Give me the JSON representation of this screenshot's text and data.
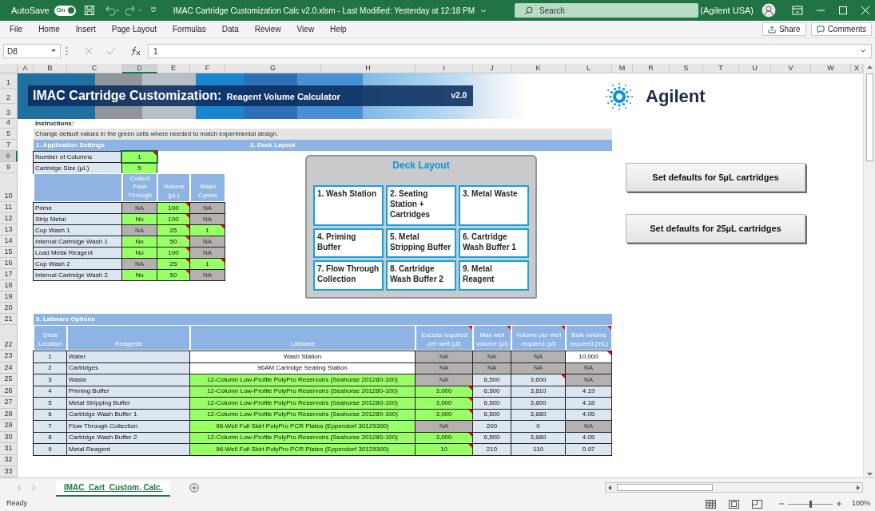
{
  "title_bar": {
    "autosave_label": "AutoSave",
    "autosave": {
      "label": "On",
      "on": true
    },
    "file_title": "IMAC Cartridge Customization Calc v2.0.xlsm  -  Last Modified: Yesterday at 12:18 PM",
    "search_placeholder": "Search",
    "account": "(Agilent USA)"
  },
  "menu": [
    "File",
    "Home",
    "Insert",
    "Page Layout",
    "Formulas",
    "Data",
    "Review",
    "View",
    "Help"
  ],
  "share_label": "Share",
  "comments_label": "Comments",
  "formula_bar": {
    "name_box": "D8",
    "formula": "1"
  },
  "columns": [
    {
      "label": "A",
      "selected": false
    },
    {
      "label": "B",
      "selected": false
    },
    {
      "label": "C",
      "selected": false
    },
    {
      "label": "D",
      "selected": true
    },
    {
      "label": "E",
      "selected": false
    },
    {
      "label": "F",
      "selected": false
    },
    {
      "label": "G",
      "selected": false
    },
    {
      "label": "H",
      "selected": false
    },
    {
      "label": "I",
      "selected": false
    },
    {
      "label": "J",
      "selected": false
    },
    {
      "label": "K",
      "selected": false
    },
    {
      "label": "L",
      "selected": false
    },
    {
      "label": "M",
      "selected": false
    },
    {
      "label": "R",
      "selected": false
    },
    {
      "label": "S",
      "selected": false
    },
    {
      "label": "T",
      "selected": false
    },
    {
      "label": "U",
      "selected": false
    },
    {
      "label": "V",
      "selected": false
    },
    {
      "label": "W",
      "selected": false
    },
    {
      "label": "X",
      "selected": false
    }
  ],
  "rows": [
    {
      "label": "1",
      "selected": false
    },
    {
      "label": "2",
      "selected": false
    },
    {
      "label": "3",
      "selected": false
    },
    {
      "label": "4",
      "selected": false
    },
    {
      "label": "5",
      "selected": false
    },
    {
      "label": "7",
      "selected": false
    },
    {
      "label": "8",
      "selected": true
    },
    {
      "label": "9",
      "selected": false
    },
    {
      "label": "10",
      "selected": false
    },
    {
      "label": "11",
      "selected": false
    },
    {
      "label": "12",
      "selected": false
    },
    {
      "label": "13",
      "selected": false
    },
    {
      "label": "14",
      "selected": false
    },
    {
      "label": "15",
      "selected": false
    },
    {
      "label": "16",
      "selected": false
    },
    {
      "label": "17",
      "selected": false
    },
    {
      "label": "18",
      "selected": false
    },
    {
      "label": "19",
      "selected": false
    },
    {
      "label": "20",
      "selected": false
    },
    {
      "label": "21",
      "selected": false
    },
    {
      "label": "22",
      "selected": false
    },
    {
      "label": "23",
      "selected": false
    },
    {
      "label": "24",
      "selected": false
    },
    {
      "label": "25",
      "selected": false
    },
    {
      "label": "26",
      "selected": false
    },
    {
      "label": "27",
      "selected": false
    },
    {
      "label": "28",
      "selected": false
    },
    {
      "label": "29",
      "selected": false
    },
    {
      "label": "30",
      "selected": false
    },
    {
      "label": "31",
      "selected": false
    },
    {
      "label": "32",
      "selected": false
    },
    {
      "label": "33",
      "selected": false
    }
  ],
  "banner": {
    "title": "IMAC Cartridge Customization:",
    "subtitle": "Reagent Volume Calculator",
    "version": "v2.0"
  },
  "logo": "Agilent",
  "instructions": {
    "label": "Instructions:",
    "text": "Change default values in the green cells where needed to match experimental design."
  },
  "sections": [
    "1. Application Settings",
    "2. Deck Layout",
    "3. Labware Options"
  ],
  "settings": [
    {
      "label": "Number of Columns",
      "value": "1",
      "selected": true,
      "comment": true
    },
    {
      "label": "Cartridge Size (µL)",
      "value": "5",
      "selected": false,
      "comment": false
    }
  ],
  "steps_table": {
    "columns": [
      "Collect Flow Through",
      "Volume (µL)",
      "Wash Cycles"
    ],
    "rows": [
      {
        "name": "Prime",
        "cells": [
          {
            "value": "NA",
            "kind": "na",
            "comment": false
          },
          {
            "value": "100",
            "kind": "input",
            "comment": true
          },
          {
            "value": "NA",
            "kind": "na",
            "comment": false
          }
        ]
      },
      {
        "name": "Strip Metal",
        "cells": [
          {
            "value": "No",
            "kind": "input",
            "comment": false
          },
          {
            "value": "100",
            "kind": "input",
            "comment": true
          },
          {
            "value": "NA",
            "kind": "na",
            "comment": false
          }
        ]
      },
      {
        "name": "Cup Wash 1",
        "cells": [
          {
            "value": "NA",
            "kind": "na",
            "comment": false
          },
          {
            "value": "25",
            "kind": "input",
            "comment": true
          },
          {
            "value": "1",
            "kind": "input",
            "comment": true
          }
        ]
      },
      {
        "name": "Internal Cartridge Wash 1",
        "cells": [
          {
            "value": "No",
            "kind": "input",
            "comment": false
          },
          {
            "value": "50",
            "kind": "input",
            "comment": true
          },
          {
            "value": "NA",
            "kind": "na",
            "comment": false
          }
        ]
      },
      {
        "name": "Load Metal Reagent",
        "cells": [
          {
            "value": "No",
            "kind": "input",
            "comment": false
          },
          {
            "value": "100",
            "kind": "input",
            "comment": true
          },
          {
            "value": "NA",
            "kind": "na",
            "comment": false
          }
        ]
      },
      {
        "name": "Cup Wash 2",
        "cells": [
          {
            "value": "NA",
            "kind": "na",
            "comment": false
          },
          {
            "value": "25",
            "kind": "input",
            "comment": true
          },
          {
            "value": "1",
            "kind": "input",
            "comment": true
          }
        ]
      },
      {
        "name": "Internal Cartridge Wash 2",
        "cells": [
          {
            "value": "No",
            "kind": "input",
            "comment": false
          },
          {
            "value": "50",
            "kind": "input",
            "comment": true
          },
          {
            "value": "NA",
            "kind": "na",
            "comment": false
          }
        ]
      }
    ]
  },
  "deck_layout": {
    "title": "Deck Layout",
    "slots": [
      "1. Wash Station",
      "2. Seating Station + Cartridges",
      "3. Metal Waste",
      "4. Priming Buffer",
      "5. Metal Stripping Buffer",
      "6. Cartridge Wash Buffer 1",
      "7. Flow Through Collection",
      "8. Cartridge Wash Buffer 2",
      "9. Metal Reagent"
    ]
  },
  "buttons": [
    "Set defaults for 5µL cartridges",
    "Set defaults for 25µL cartridges"
  ],
  "labware_table": {
    "columns": [
      {
        "label": "Deck Location",
        "comment": false
      },
      {
        "label": "Reagents",
        "comment": false
      },
      {
        "label": "Labware",
        "comment": false
      },
      {
        "label": "Excess required per well (µl)",
        "comment": true
      },
      {
        "label": "Max well volume (µl)",
        "comment": true
      },
      {
        "label": "Volume per well required (µl)",
        "comment": true
      },
      {
        "label": "Bulk volume required (mL)",
        "comment": true
      }
    ],
    "rows": [
      {
        "cells": [
          {
            "value": "1",
            "kind": "calc",
            "comment": false
          },
          {
            "value": "Water",
            "kind": "calc",
            "comment": false
          },
          {
            "value": "Wash Station",
            "kind": "plain",
            "comment": false
          },
          {
            "value": "NA",
            "kind": "na",
            "comment": false
          },
          {
            "value": "NA",
            "kind": "na",
            "comment": false
          },
          {
            "value": "NA",
            "kind": "na",
            "comment": false
          },
          {
            "value": "10,000",
            "kind": "plain",
            "comment": true
          }
        ]
      },
      {
        "cells": [
          {
            "value": "2",
            "kind": "calc",
            "comment": false
          },
          {
            "value": "Cartridges",
            "kind": "calc",
            "comment": false
          },
          {
            "value": "96AM Cartridge Seating Station",
            "kind": "plain",
            "comment": false
          },
          {
            "value": "NA",
            "kind": "na",
            "comment": false
          },
          {
            "value": "NA",
            "kind": "na",
            "comment": false
          },
          {
            "value": "NA",
            "kind": "na",
            "comment": false
          },
          {
            "value": "NA",
            "kind": "na",
            "comment": false
          }
        ]
      },
      {
        "cells": [
          {
            "value": "3",
            "kind": "calc",
            "comment": false
          },
          {
            "value": "Waste",
            "kind": "calc",
            "comment": false
          },
          {
            "value": "12-Column Low-Profile PolyPro Reservoirs (Seahorse 201280-100)",
            "kind": "input",
            "comment": false
          },
          {
            "value": "NA",
            "kind": "na",
            "comment": false
          },
          {
            "value": "6,500",
            "kind": "calc",
            "comment": false
          },
          {
            "value": "3,600",
            "kind": "calc",
            "comment": true
          },
          {
            "value": "NA",
            "kind": "na",
            "comment": false
          }
        ]
      },
      {
        "cells": [
          {
            "value": "4",
            "kind": "calc",
            "comment": false
          },
          {
            "value": "Priming Buffer",
            "kind": "calc",
            "comment": false
          },
          {
            "value": "12-Column Low-Profile PolyPro Reservoirs (Seahorse 201280-100)",
            "kind": "input",
            "comment": false
          },
          {
            "value": "3,000",
            "kind": "input",
            "comment": true
          },
          {
            "value": "6,500",
            "kind": "calc",
            "comment": false
          },
          {
            "value": "3,810",
            "kind": "calc",
            "comment": false
          },
          {
            "value": "4.19",
            "kind": "calc",
            "comment": false
          }
        ]
      },
      {
        "cells": [
          {
            "value": "5",
            "kind": "calc",
            "comment": false
          },
          {
            "value": "Metal Stripping Buffer",
            "kind": "calc",
            "comment": false
          },
          {
            "value": "12-Column Low-Profile PolyPro Reservoirs (Seahorse 201280-100)",
            "kind": "input",
            "comment": false
          },
          {
            "value": "3,000",
            "kind": "input",
            "comment": true
          },
          {
            "value": "6,500",
            "kind": "calc",
            "comment": false
          },
          {
            "value": "3,800",
            "kind": "calc",
            "comment": false
          },
          {
            "value": "4.18",
            "kind": "calc",
            "comment": false
          }
        ]
      },
      {
        "cells": [
          {
            "value": "6",
            "kind": "calc",
            "comment": false
          },
          {
            "value": "Cartridge Wash Buffer 1",
            "kind": "calc",
            "comment": false
          },
          {
            "value": "12-Column Low-Profile PolyPro Reservoirs (Seahorse 201280-100)",
            "kind": "input",
            "comment": false
          },
          {
            "value": "3,000",
            "kind": "input",
            "comment": true
          },
          {
            "value": "6,500",
            "kind": "calc",
            "comment": false
          },
          {
            "value": "3,680",
            "kind": "calc",
            "comment": false
          },
          {
            "value": "4.05",
            "kind": "calc",
            "comment": false
          }
        ]
      },
      {
        "cells": [
          {
            "value": "7",
            "kind": "calc",
            "comment": false
          },
          {
            "value": "Flow Through Collection",
            "kind": "calc",
            "comment": false
          },
          {
            "value": "96-Well Full Skirt PolyPro PCR Plates (Eppendorf 30129300)",
            "kind": "input",
            "comment": false
          },
          {
            "value": "NA",
            "kind": "na",
            "comment": false
          },
          {
            "value": "200",
            "kind": "calc",
            "comment": false
          },
          {
            "value": "0",
            "kind": "calc",
            "comment": false
          },
          {
            "value": "NA",
            "kind": "na",
            "comment": false
          }
        ]
      },
      {
        "cells": [
          {
            "value": "8",
            "kind": "calc",
            "comment": false
          },
          {
            "value": "Cartridge Wash Buffer 2",
            "kind": "calc",
            "comment": false
          },
          {
            "value": "12-Column Low-Profile PolyPro Reservoirs (Seahorse 201280-100)",
            "kind": "input",
            "comment": false
          },
          {
            "value": "3,000",
            "kind": "input",
            "comment": true
          },
          {
            "value": "6,500",
            "kind": "calc",
            "comment": false
          },
          {
            "value": "3,680",
            "kind": "calc",
            "comment": false
          },
          {
            "value": "4.05",
            "kind": "calc",
            "comment": false
          }
        ]
      },
      {
        "cells": [
          {
            "value": "9",
            "kind": "calc",
            "comment": false
          },
          {
            "value": "Metal Reagent",
            "kind": "calc",
            "comment": false
          },
          {
            "value": "96-Well Full Skirt PolyPro PCR Plates (Eppendorf 30129300)",
            "kind": "input",
            "comment": false
          },
          {
            "value": "10",
            "kind": "input",
            "comment": true
          },
          {
            "value": "210",
            "kind": "calc",
            "comment": false
          },
          {
            "value": "110",
            "kind": "calc",
            "comment": false
          },
          {
            "value": "0.97",
            "kind": "calc",
            "comment": false
          }
        ]
      }
    ]
  },
  "sheet_tabs": [
    {
      "label": "IMAC_Cart_Custom. Calc.",
      "selected": true
    }
  ],
  "status": "Ready",
  "zoom": {
    "label": "100%",
    "level": 0.5
  }
}
